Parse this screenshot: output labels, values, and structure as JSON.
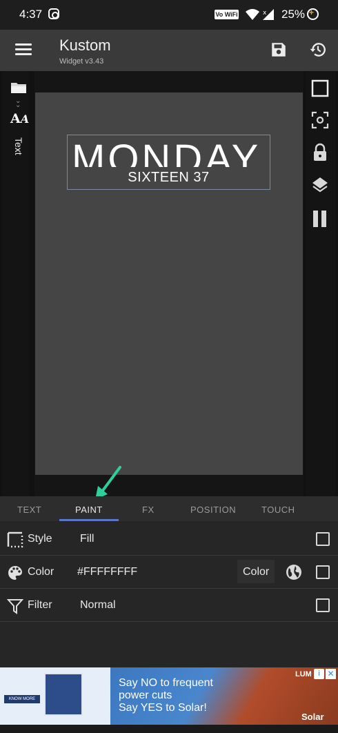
{
  "status_bar": {
    "time": "4:37",
    "network_badge": "Vo WiFi",
    "battery": "25%"
  },
  "app_bar": {
    "title": "Kustom",
    "subtitle": "Widget v3.43",
    "icons": [
      "menu-icon",
      "save-icon",
      "history-icon"
    ]
  },
  "editor": {
    "left_rail": {
      "icons": [
        "folder-icon",
        "double-chevron-icon",
        "text-type-icon"
      ],
      "item_label": "Text"
    },
    "right_rail": {
      "icons": [
        "square-icon",
        "focus-icon",
        "lock-icon",
        "layers-icon",
        "pause-icon"
      ]
    },
    "widget": {
      "day_text": "MONDAY",
      "time_text": "SIXTEEN 37"
    }
  },
  "tabs": {
    "items": [
      {
        "label": "TEXT"
      },
      {
        "label": "PAINT"
      },
      {
        "label": "FX"
      },
      {
        "label": "POSITION"
      },
      {
        "label": "TOUCH"
      }
    ],
    "active": "PAINT"
  },
  "properties": {
    "style": {
      "label": "Style",
      "value": "Fill",
      "icon": "dotted-square-icon"
    },
    "color": {
      "label": "Color",
      "value": "#FFFFFFFF",
      "button": "Color",
      "icon": "palette-icon"
    },
    "filter": {
      "label": "Filter",
      "value": "Normal",
      "icon": "funnel-icon"
    }
  },
  "ad": {
    "line1": "Say NO to frequent",
    "line2": "power cuts",
    "line3": "Say YES to Solar!",
    "brand_top": "LUM",
    "brand_bottom": "Solar",
    "logo_text": "KNOW MORE"
  },
  "colors": {
    "accent": "#5979c6",
    "arrow": "#2ecf9a",
    "canvas": "#454545",
    "appbar": "#3a3a3a"
  }
}
